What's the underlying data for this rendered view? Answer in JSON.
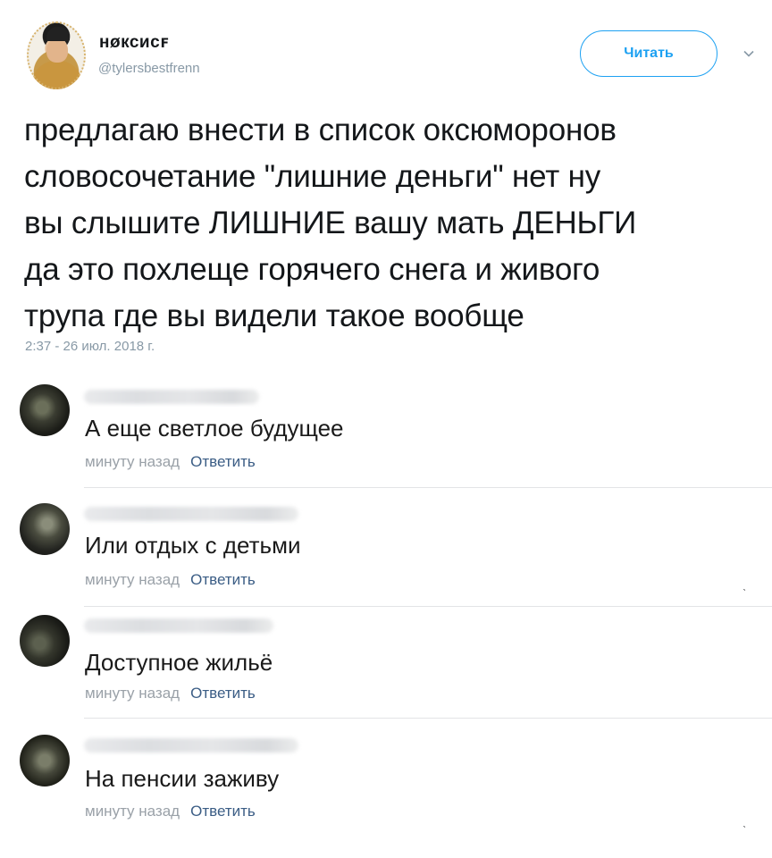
{
  "author": {
    "name": "нøксисꜰ",
    "handle": "@tylersbestfrenn"
  },
  "follow_button": {
    "label": "Читать"
  },
  "tweet": {
    "lines": [
      "предлагаю внести в список оксюморонов",
      "словосочетание \"лишние деньги\" нет ну",
      "вы слышите ЛИШНИЕ вашу мать ДЕНЬГИ",
      "да это похлеще горячего снега и живого",
      "трупа где вы видели такое вообще"
    ],
    "timestamp": "2:37 - 26 июл. 2018 г."
  },
  "comments": [
    {
      "text": "А еще светлое будущее",
      "time": "минуту назад",
      "reply": "Ответить"
    },
    {
      "text": "Или отдых с детьми",
      "time": "минуту назад",
      "reply": "Ответить"
    },
    {
      "text": "Доступное жильё",
      "time": "минуту назад",
      "reply": "Ответить"
    },
    {
      "text": "На пенсии заживу",
      "time": "минуту назад",
      "reply": "Ответить"
    }
  ],
  "icons": {
    "follow_menu": "chevron-down-icon"
  },
  "colors": {
    "accent": "#1da1f2",
    "secondary_text": "#8899a6",
    "reply_link": "#3b5d85"
  }
}
